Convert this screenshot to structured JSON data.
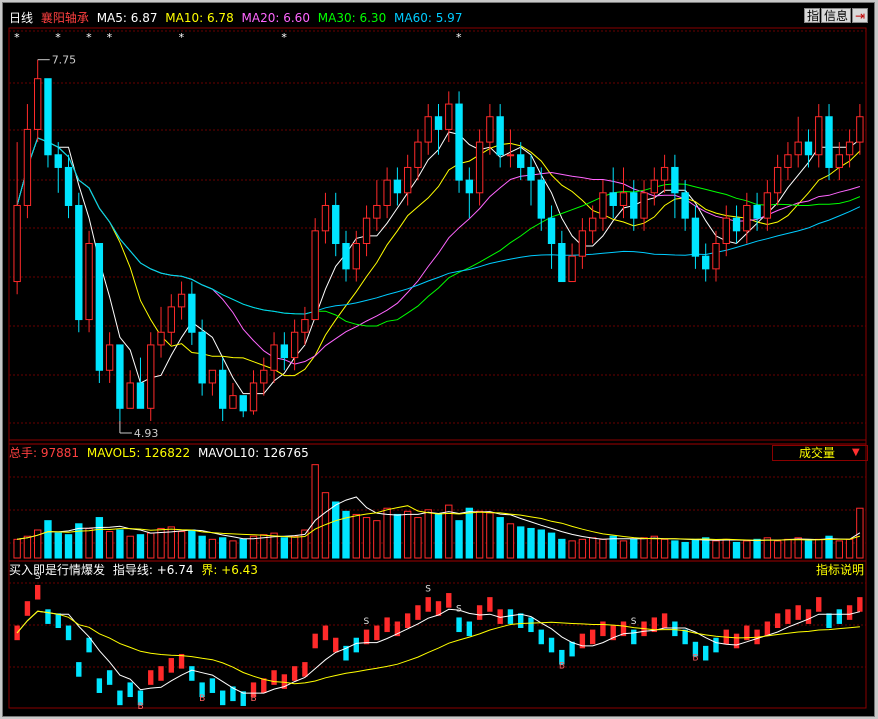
{
  "header": {
    "period": "日线",
    "stock_name": "襄阳轴承",
    "ma": [
      {
        "label": "MA5: 6.87",
        "color": "#ffffff"
      },
      {
        "label": "MA10: 6.78",
        "color": "#ffff00"
      },
      {
        "label": "MA20: 6.60",
        "color": "#ff66ff"
      },
      {
        "label": "MA30: 6.30",
        "color": "#00ff00"
      },
      {
        "label": "MA60: 5.97",
        "color": "#00ccff"
      }
    ],
    "buttons": {
      "index": "指",
      "info": "信息",
      "exit": "⇥"
    }
  },
  "price_chart": {
    "high_label": "7.75",
    "low_label": "4.93",
    "star_glyph": "*",
    "up_color": "#ff2a2a",
    "down_color": "#00e5ff"
  },
  "volume_panel": {
    "total_label": "总手: ",
    "total_value": "97881",
    "mavol5": "MAVOL5: 126822",
    "mavol10": "MAVOL10: 126765",
    "indicator_name": "成交量",
    "dropdown_arrow": "▼"
  },
  "indicator_panel": {
    "title": "买入即是行情爆发",
    "guide_label": "指导线: ",
    "guide_value": "+6.74",
    "bound_label": "界: ",
    "bound_value": "+6.43",
    "help": "指标说明",
    "sell_mark": "S",
    "buy_mark": "B"
  },
  "chart_data": {
    "type": "candlestick",
    "series": [
      {
        "name": "K",
        "values": [
          [
            6.0,
            6.6,
            7.1,
            5.9
          ],
          [
            6.6,
            7.2,
            7.4,
            6.5
          ],
          [
            7.2,
            7.6,
            7.75,
            7.1
          ],
          [
            7.6,
            7.0,
            7.6,
            6.9
          ],
          [
            7.0,
            6.9,
            7.1,
            6.7
          ],
          [
            6.9,
            6.6,
            7.0,
            6.5
          ],
          [
            6.6,
            5.7,
            6.7,
            5.6
          ],
          [
            5.7,
            6.3,
            6.4,
            5.6
          ],
          [
            6.3,
            5.3,
            6.3,
            5.2
          ],
          [
            5.3,
            5.5,
            5.6,
            5.2
          ],
          [
            5.5,
            5.0,
            5.5,
            4.9
          ],
          [
            5.0,
            5.2,
            5.3,
            5.0
          ],
          [
            5.2,
            5.0,
            5.4,
            5.0
          ],
          [
            5.0,
            5.5,
            5.6,
            4.9
          ],
          [
            5.5,
            5.6,
            5.8,
            5.4
          ],
          [
            5.6,
            5.8,
            5.9,
            5.5
          ],
          [
            5.8,
            5.9,
            6.0,
            5.7
          ],
          [
            5.9,
            5.6,
            6.0,
            5.5
          ],
          [
            5.6,
            5.2,
            5.7,
            5.1
          ],
          [
            5.2,
            5.3,
            5.3,
            5.1
          ],
          [
            5.3,
            5.0,
            5.4,
            4.9
          ],
          [
            5.0,
            5.1,
            5.2,
            5.0
          ],
          [
            5.1,
            4.98,
            5.1,
            4.93
          ],
          [
            4.98,
            5.2,
            5.3,
            4.95
          ],
          [
            5.2,
            5.3,
            5.4,
            5.1
          ],
          [
            5.3,
            5.5,
            5.6,
            5.2
          ],
          [
            5.5,
            5.4,
            5.6,
            5.3
          ],
          [
            5.4,
            5.6,
            5.7,
            5.3
          ],
          [
            5.6,
            5.7,
            5.8,
            5.5
          ],
          [
            5.7,
            6.4,
            6.5,
            5.7
          ],
          [
            6.4,
            6.6,
            6.7,
            6.3
          ],
          [
            6.6,
            6.3,
            6.7,
            6.2
          ],
          [
            6.3,
            6.1,
            6.4,
            6.0
          ],
          [
            6.1,
            6.3,
            6.4,
            6.0
          ],
          [
            6.3,
            6.5,
            6.6,
            6.2
          ],
          [
            6.5,
            6.6,
            6.8,
            6.4
          ],
          [
            6.6,
            6.8,
            6.9,
            6.5
          ],
          [
            6.8,
            6.7,
            6.9,
            6.6
          ],
          [
            6.7,
            6.9,
            7.0,
            6.6
          ],
          [
            6.9,
            7.1,
            7.2,
            6.8
          ],
          [
            7.1,
            7.3,
            7.4,
            7.0
          ],
          [
            7.3,
            7.2,
            7.4,
            7.0
          ],
          [
            7.2,
            7.4,
            7.5,
            7.1
          ],
          [
            7.4,
            6.8,
            7.5,
            6.7
          ],
          [
            6.8,
            6.7,
            6.9,
            6.5
          ],
          [
            6.7,
            7.1,
            7.2,
            6.6
          ],
          [
            7.1,
            7.3,
            7.4,
            7.0
          ],
          [
            7.3,
            7.0,
            7.4,
            6.9
          ],
          [
            7.0,
            7.0,
            7.2,
            6.9
          ],
          [
            7.0,
            6.9,
            7.1,
            6.8
          ],
          [
            6.9,
            6.8,
            7.0,
            6.6
          ],
          [
            6.8,
            6.5,
            6.9,
            6.4
          ],
          [
            6.5,
            6.3,
            6.6,
            6.1
          ],
          [
            6.3,
            6.0,
            6.4,
            6.0
          ],
          [
            6.0,
            6.2,
            6.3,
            6.0
          ],
          [
            6.2,
            6.4,
            6.5,
            6.1
          ],
          [
            6.4,
            6.5,
            6.6,
            6.3
          ],
          [
            6.5,
            6.7,
            6.8,
            6.4
          ],
          [
            6.7,
            6.6,
            6.9,
            6.5
          ],
          [
            6.6,
            6.7,
            6.9,
            6.5
          ],
          [
            6.7,
            6.5,
            6.8,
            6.4
          ],
          [
            6.5,
            6.7,
            6.8,
            6.4
          ],
          [
            6.7,
            6.8,
            6.9,
            6.6
          ],
          [
            6.8,
            6.9,
            7.0,
            6.7
          ],
          [
            6.9,
            6.7,
            7.0,
            6.5
          ],
          [
            6.7,
            6.5,
            6.8,
            6.4
          ],
          [
            6.5,
            6.2,
            6.6,
            6.1
          ],
          [
            6.2,
            6.1,
            6.3,
            6.0
          ],
          [
            6.1,
            6.3,
            6.4,
            6.0
          ],
          [
            6.3,
            6.5,
            6.6,
            6.2
          ],
          [
            6.5,
            6.4,
            6.6,
            6.3
          ],
          [
            6.4,
            6.6,
            6.7,
            6.3
          ],
          [
            6.6,
            6.5,
            6.7,
            6.4
          ],
          [
            6.5,
            6.7,
            6.8,
            6.4
          ],
          [
            6.7,
            6.9,
            7.0,
            6.6
          ],
          [
            6.9,
            7.0,
            7.1,
            6.8
          ],
          [
            7.0,
            7.1,
            7.3,
            6.9
          ],
          [
            7.1,
            7.0,
            7.2,
            6.9
          ],
          [
            7.0,
            7.3,
            7.4,
            6.9
          ],
          [
            7.3,
            6.9,
            7.4,
            6.8
          ],
          [
            6.9,
            7.0,
            7.1,
            6.8
          ],
          [
            7.0,
            7.1,
            7.2,
            6.9
          ],
          [
            7.1,
            7.3,
            7.4,
            7.0
          ]
        ]
      },
      {
        "name": "MA5",
        "color": "#ffffff"
      },
      {
        "name": "MA10",
        "color": "#ffff00"
      },
      {
        "name": "MA20",
        "color": "#ff66ff"
      },
      {
        "name": "MA30",
        "color": "#00ff00"
      },
      {
        "name": "MA60",
        "color": "#00ccff"
      }
    ],
    "volume": [
      60,
      70,
      90,
      120,
      80,
      75,
      110,
      95,
      130,
      85,
      90,
      70,
      75,
      80,
      95,
      100,
      85,
      90,
      70,
      60,
      65,
      55,
      60,
      70,
      75,
      80,
      65,
      70,
      90,
      300,
      210,
      180,
      150,
      140,
      130,
      120,
      160,
      140,
      150,
      130,
      155,
      140,
      170,
      120,
      160,
      150,
      145,
      130,
      110,
      100,
      95,
      90,
      80,
      60,
      55,
      60,
      65,
      60,
      70,
      55,
      60,
      65,
      70,
      60,
      55,
      50,
      60,
      65,
      55,
      60,
      50,
      55,
      60,
      65,
      55,
      60,
      65,
      55,
      60,
      70,
      55,
      60,
      160
    ],
    "indicator": {
      "guide_line": 6.74,
      "bound_line": 6.43
    },
    "ylim": [
      4.75,
      8.0
    ]
  }
}
